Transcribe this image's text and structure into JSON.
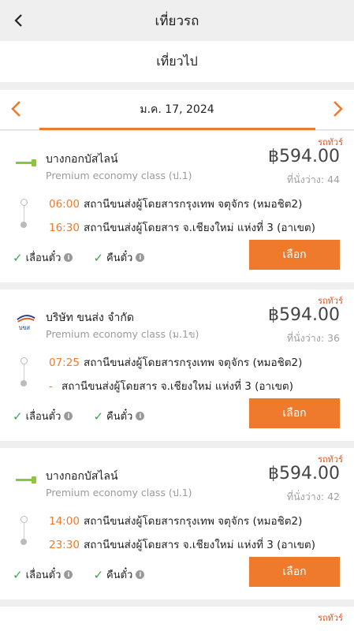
{
  "header": {
    "title": "เที่ยวรถ",
    "back_icon": "chevron-left-icon"
  },
  "subheader": {
    "label": "เที่ยวไป"
  },
  "datebar": {
    "date": "ม.ค. 17, 2024",
    "accent": "#f07a2c"
  },
  "trips": [
    {
      "tag": "รถทัวร์",
      "company": "บางกอกบัสไลน์",
      "class": "Premium economy class (ป.1)",
      "price": "฿594.00",
      "seats": "ที่นั่งว่าง: 44",
      "depart_time": "06:00",
      "depart_station": "สถานีขนส่งผู้โดยสารกรุงเทพ จตุจักร (หมอชิต2)",
      "arrive_time": "16:30",
      "arrive_station": "สถานีขนส่งผู้โดยสาร จ.เชียงใหม่ แห่งที่ 3 (อาเขต)",
      "opt1": "เลื่อนตั๋ว",
      "opt2": "คืนตั๋ว",
      "button": "เลือก"
    },
    {
      "tag": "รถทัวร์",
      "company": "บริษัท ขนส่ง จำกัด",
      "class": "Premium economy class (ม.1ข)",
      "price": "฿594.00",
      "seats": "ที่นั่งว่าง: 36",
      "depart_time": "07:25",
      "depart_station": "สถานีขนส่งผู้โดยสารกรุงเทพ จตุจักร (หมอชิต2)",
      "arrive_time": "-",
      "arrive_station": "สถานีขนส่งผู้โดยสาร จ.เชียงใหม่ แห่งที่ 3 (อาเขต)",
      "opt1": "เลื่อนตั๋ว",
      "opt2": "คืนตั๋ว",
      "button": "เลือก"
    },
    {
      "tag": "รถทัวร์",
      "company": "บางกอกบัสไลน์",
      "class": "Premium economy class (ป.1)",
      "price": "฿594.00",
      "seats": "ที่นั่งว่าง: 42",
      "depart_time": "14:00",
      "depart_station": "สถานีขนส่งผู้โดยสารกรุงเทพ จตุจักร (หมอชิต2)",
      "arrive_time": "23:30",
      "arrive_station": "สถานีขนส่งผู้โดยสาร จ.เชียงใหม่ แห่งที่ 3 (อาเขต)",
      "opt1": "เลื่อนตั๋ว",
      "opt2": "คืนตั๋ว",
      "button": "เลือก"
    },
    {
      "tag": "รถทัวร์"
    }
  ]
}
